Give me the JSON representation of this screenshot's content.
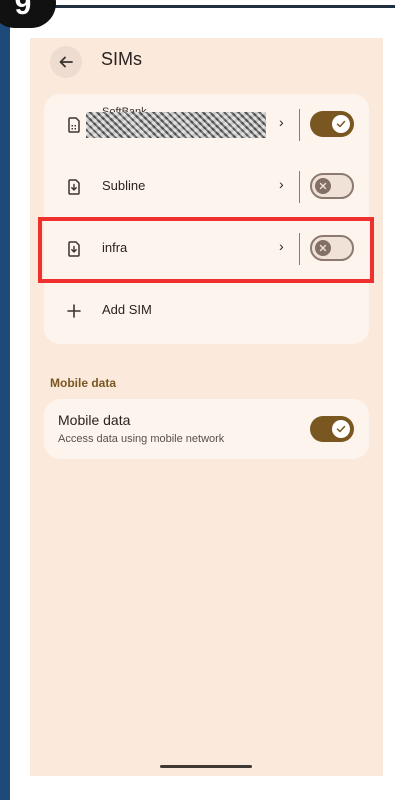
{
  "step_badge": "9",
  "header": {
    "title": "SIMs"
  },
  "sims": [
    {
      "label": "SoftBank",
      "enabled": true,
      "redacted": true
    },
    {
      "label": "Subline",
      "enabled": false
    },
    {
      "label": "infra",
      "enabled": false,
      "highlighted": true
    }
  ],
  "add_sim_label": "Add SIM",
  "mobile_data": {
    "section_label": "Mobile data",
    "title": "Mobile data",
    "subtitle": "Access data using mobile network",
    "enabled": true
  },
  "colors": {
    "accent": "#7a5720",
    "background": "#fbeadc",
    "card": "#fdf4ee",
    "highlight": "#f02f2f"
  }
}
